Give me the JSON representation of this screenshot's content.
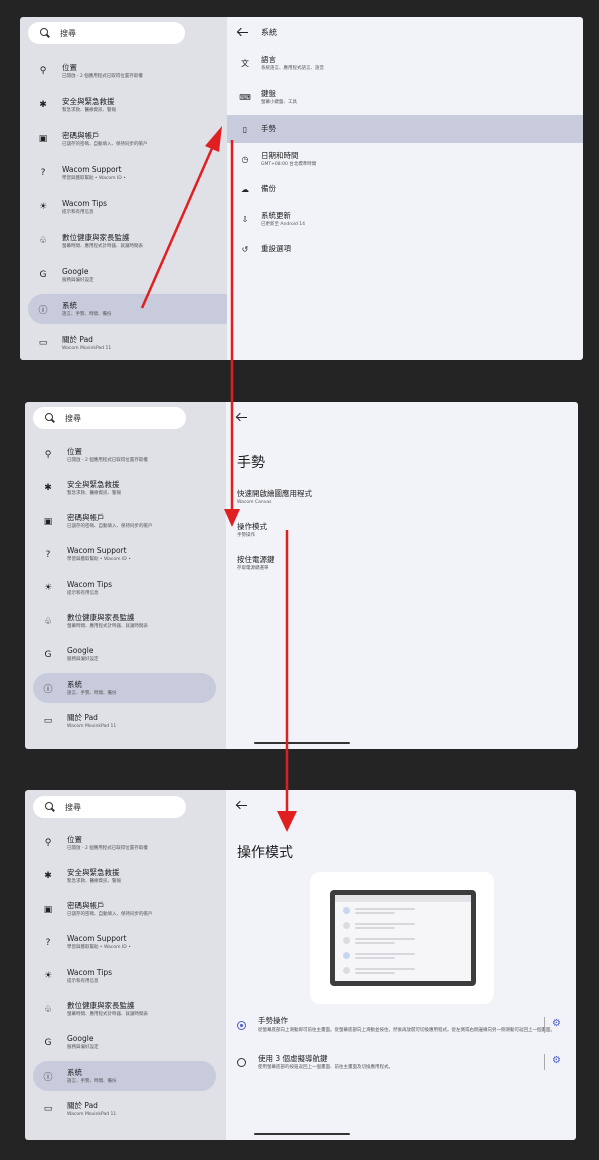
{
  "search": {
    "placeholder": "搜尋"
  },
  "sidebar": {
    "items": [
      {
        "icon": "location-icon",
        "glyph": "⚲",
        "title": "位置",
        "subtitle": "已開啟 - 2 個應用程式已取得位置存取權"
      },
      {
        "icon": "asterisk-icon",
        "glyph": "✱",
        "title": "安全與緊急救援",
        "subtitle": "緊急求救、醫療資訊、警報"
      },
      {
        "icon": "account-card-icon",
        "glyph": "▣",
        "title": "密碼與帳戶",
        "subtitle": "已儲存的密碼、自動填入、保持同步的帳戶"
      },
      {
        "icon": "help-icon",
        "glyph": "?",
        "title": "Wacom Support",
        "subtitle": "學習與獲取幫助 • Wacom ID •"
      },
      {
        "icon": "lightbulb-icon",
        "glyph": "☀",
        "title": "Wacom Tips",
        "subtitle": "提示和有用信息"
      },
      {
        "icon": "wellbeing-icon",
        "glyph": "♧",
        "title": "數位健康與家長監護",
        "subtitle": "螢幕時間、應用程式計時器、就寢時間表"
      },
      {
        "icon": "google-icon",
        "glyph": "G",
        "title": "Google",
        "subtitle": "服務與偏好設定"
      },
      {
        "icon": "info-icon",
        "glyph": "ⓘ",
        "title": "系統",
        "subtitle": "語言、手勢、時間、備份"
      },
      {
        "icon": "tablet-icon",
        "glyph": "▭",
        "title": "關於 Pad",
        "subtitle": "Wacom MovinkPad 11"
      }
    ]
  },
  "screen1": {
    "header": "系統",
    "items": [
      {
        "icon": "translate-icon",
        "glyph": "文",
        "title": "語言",
        "subtitle": "系統語言、應用程式語言、語音"
      },
      {
        "icon": "keyboard-icon",
        "glyph": "⌨",
        "title": "鍵盤",
        "subtitle": "螢幕小鍵盤、工具"
      },
      {
        "icon": "gesture-phone-icon",
        "glyph": "▯",
        "title": "手勢",
        "subtitle": ""
      },
      {
        "icon": "clock-icon",
        "glyph": "◷",
        "title": "日期和時間",
        "subtitle": "GMT+08:00 台北標準時間"
      },
      {
        "icon": "cloud-backup-icon",
        "glyph": "☁",
        "title": "備份",
        "subtitle": ""
      },
      {
        "icon": "system-update-icon",
        "glyph": "⇩",
        "title": "系統更新",
        "subtitle": "已更新至 Android 14"
      },
      {
        "icon": "reset-icon",
        "glyph": "↺",
        "title": "重設選項",
        "subtitle": ""
      }
    ]
  },
  "screen2": {
    "title": "手勢",
    "items": [
      {
        "title": "快速開啟繪圖應用程式",
        "subtitle": "Wacom Canvas"
      },
      {
        "title": "操作模式",
        "subtitle": "手勢操作"
      },
      {
        "title": "按住電源鍵",
        "subtitle": "存取電源鍵選單"
      }
    ]
  },
  "screen3": {
    "title": "操作模式",
    "options": [
      {
        "title": "手勢操作",
        "subtitle": "從螢幕底部向上滑動即可前往主畫面。從螢幕底部向上滑動並按住，然後再放開可切換應用程式。從左側或右側邊緣向另一側滑動可返回上一個畫面。",
        "selected": true
      },
      {
        "title": "使用 3 個虛擬導航鍵",
        "subtitle": "使用螢幕底部的按鈕返回上一個畫面、前往主畫面及切換應用程式。",
        "selected": false
      }
    ]
  },
  "colors": {
    "annotation_arrow": "#e02020",
    "accent": "#4a5cc8",
    "selected_bg": "#c7cbdc"
  }
}
